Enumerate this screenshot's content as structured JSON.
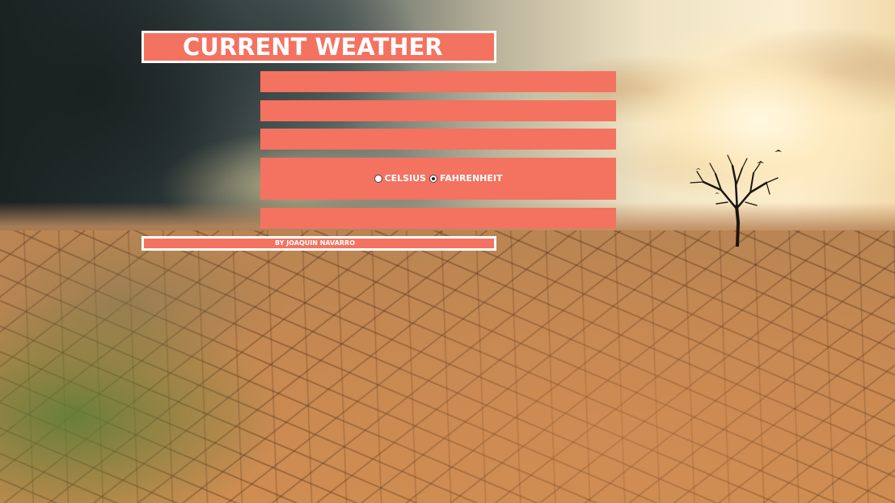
{
  "header": {
    "title": "CURRENT WEATHER"
  },
  "weather": {
    "location": "",
    "temperature": "",
    "description": "",
    "extra": ""
  },
  "units": {
    "options": [
      {
        "label": "CELSIUS",
        "selected": false
      },
      {
        "label": "FAHRENHEIT",
        "selected": true
      }
    ]
  },
  "footer": {
    "credit": "BY JOAQUIN NAVARRO"
  },
  "colors": {
    "accent": "#f47260",
    "border": "#ffffff",
    "text": "#ffffff"
  },
  "background": {
    "scene": "dry cracked earth with stormy sky and bare tree"
  }
}
